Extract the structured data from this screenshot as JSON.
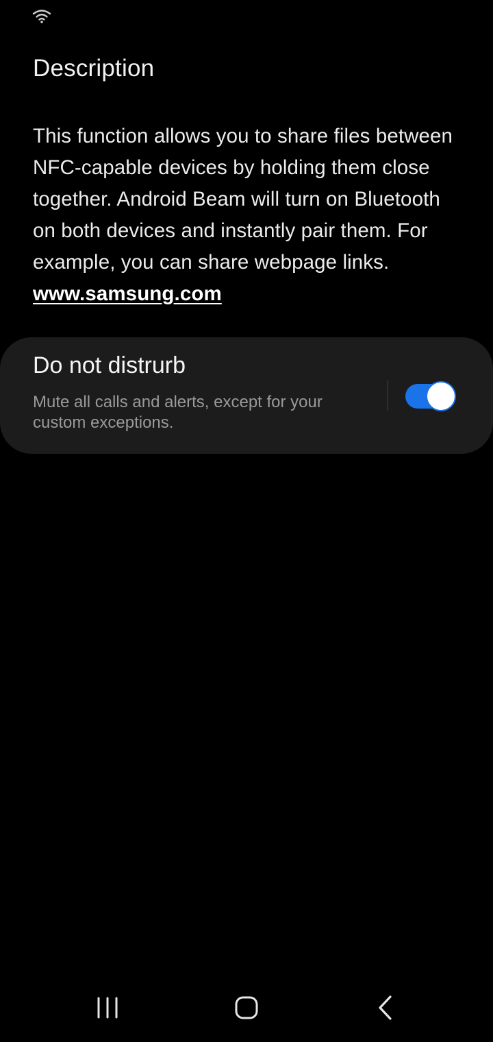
{
  "status_bar": {
    "wifi_icon": "wifi-icon"
  },
  "description_section": {
    "title": "Description",
    "body_text": "This function allows you to share files between NFC-capable devices by holding them close together. Android Beam will turn on Bluetooth on both devices and instantly pair them. For example, you can share webpage links. ",
    "link_text": "www.samsung.com"
  },
  "dnd_card": {
    "title": "Do not distrurb",
    "subtitle": "Mute all calls and alerts, except for your custom exceptions.",
    "toggle_on": true
  },
  "nav_bar": {
    "recents_icon": "recents-icon",
    "home_icon": "home-icon",
    "back_icon": "back-icon"
  },
  "colors": {
    "background": "#000000",
    "card_background": "#1c1c1c",
    "accent": "#1a73e8",
    "subtitle_text": "#9a9a9a"
  }
}
